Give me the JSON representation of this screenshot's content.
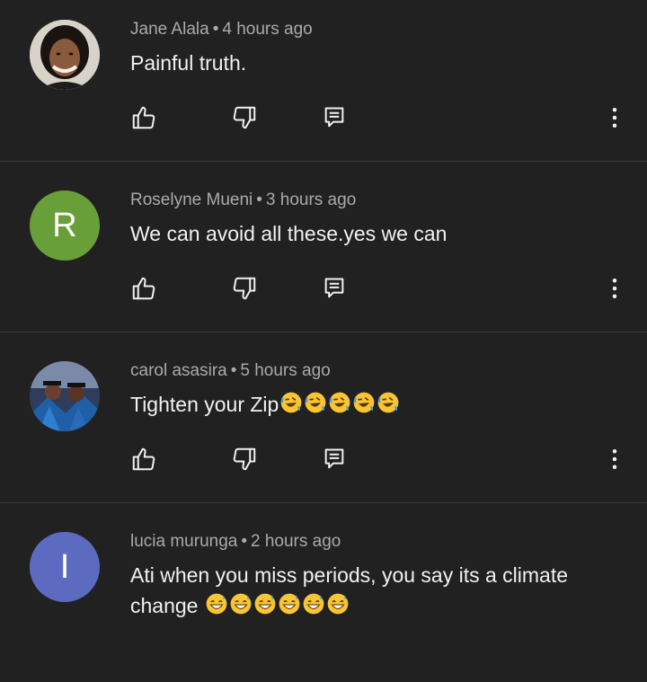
{
  "comments": [
    {
      "author": "Jane Alala",
      "time": "4 hours ago",
      "text": "Painful truth.",
      "avatar": {
        "type": "photo",
        "bg": "#c9c2b8"
      }
    },
    {
      "author": "Roselyne Mueni",
      "time": "3 hours ago",
      "text": "We can avoid all these.yes we can",
      "avatar": {
        "type": "letter",
        "letter": "R",
        "bg": "#689f38"
      }
    },
    {
      "author": "carol asasira",
      "time": "5 hours ago",
      "text": "Tighten your Zip",
      "emojis": [
        "rofl-emoji",
        "rofl-emoji",
        "rofl-emoji",
        "rofl-emoji",
        "rofl-emoji"
      ],
      "avatar": {
        "type": "photo",
        "bg": "#3a4a6a"
      }
    },
    {
      "author": "lucia murunga",
      "time": "2 hours ago",
      "text": "Ati when you miss periods, you say its a climate change",
      "emojis": [
        "grinning-sweat-emoji",
        "grinning-sweat-emoji",
        "grinning-sweat-emoji",
        "grinning-sweat-emoji",
        "grinning-sweat-emoji",
        "grinning-sweat-emoji"
      ],
      "avatar": {
        "type": "letter",
        "letter": "I",
        "bg": "#5c6bc0"
      }
    }
  ],
  "separator": "•",
  "icons": {
    "like": "thumbs-up-icon",
    "dislike": "thumbs-down-icon",
    "reply": "reply-icon",
    "more": "more-vertical-icon"
  },
  "colors": {
    "background": "#212121",
    "divider": "#3a3a3a",
    "meta_text": "#aaaaaa",
    "body_text": "#f1f1f1"
  }
}
